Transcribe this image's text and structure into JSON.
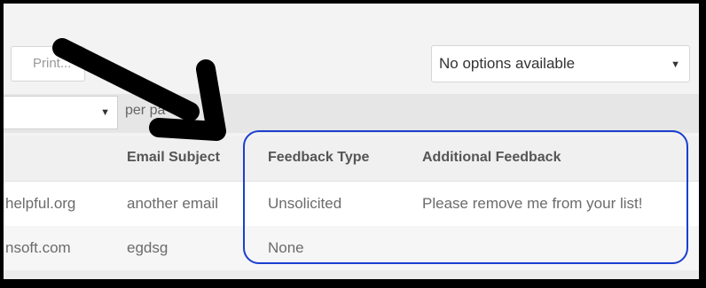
{
  "toolbar": {
    "print_label": "Print...",
    "options_select_value": "No options available",
    "caret_glyph": "▼"
  },
  "pagination": {
    "per_page_label": "per pa"
  },
  "table": {
    "columns": [
      "Email Subject",
      "Feedback Type",
      "Additional Feedback"
    ],
    "clipped_first_column": "rows show partial email domains",
    "rows": [
      {
        "email_domain": "helpful.org",
        "email_subject": "another email",
        "feedback_type": "Unsolicited",
        "additional_feedback": "Please remove me from your list!"
      },
      {
        "email_domain": "nsoft.com",
        "email_subject": "egdsg",
        "feedback_type": "None",
        "additional_feedback": ""
      }
    ]
  },
  "annotations": {
    "arrow_color": "#000000",
    "highlight_color": "#1b3fcf"
  }
}
